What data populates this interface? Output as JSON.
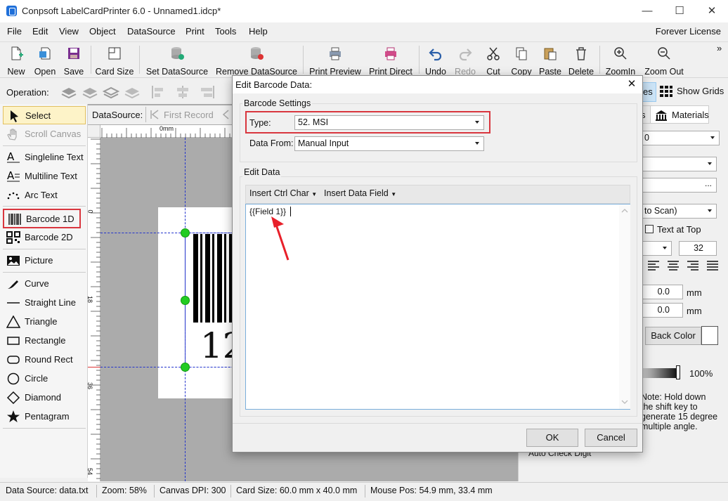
{
  "window": {
    "title": "Conpsoft LabelCardPrinter 6.0 - Unnamed1.idcp*",
    "minimize": "—",
    "maximize": "☐",
    "close": "✕"
  },
  "menu": [
    "File",
    "Edit",
    "View",
    "Object",
    "DataSource",
    "Print",
    "Tools",
    "Help"
  ],
  "license": "Forever License",
  "toolbar": [
    "New",
    "Open",
    "Save",
    "Card Size",
    "Set DataSource",
    "Remove DataSource",
    "Print Preview",
    "Print Direct",
    "Undo",
    "Redo",
    "Cut",
    "Copy",
    "Paste",
    "Delete",
    "ZoomIn",
    "Zoom Out"
  ],
  "overflow": "»",
  "operation_label": "Operation:",
  "right_tabs": {
    "partial": "es",
    "show_grids": "Show Grids"
  },
  "tools": [
    "Select",
    "Scroll Canvas",
    "Singleline Text",
    "Multiline Text",
    "Arc Text",
    "Barcode 1D",
    "Barcode 2D",
    "Picture",
    "Curve",
    "Straight Line",
    "Triangle",
    "Rectangle",
    "Round Rect",
    "Circle",
    "Diamond",
    "Pentagram"
  ],
  "datasource_bar": {
    "label": "DataSource:",
    "first_record": "First Record"
  },
  "ruler": {
    "top_zero": "0mm",
    "left_marks": [
      "0",
      "18",
      "36",
      "54"
    ]
  },
  "card": {
    "barcode_text": "12"
  },
  "right_panel": {
    "tab_partial": "s",
    "tab_materials": "Materials",
    "field1": "0",
    "field3": "...",
    "scan_combo": "to Scan)",
    "text_at_top": "Text at Top",
    "font_size": "32",
    "x_value": "0.0",
    "y_value": "0.0",
    "unit": "mm",
    "back_color": "Back Color",
    "opacity": "100%",
    "note": [
      "Note: Hold down",
      "the shift key to",
      "generate 15 degree",
      "multiple angle."
    ],
    "auto_check": "Auto Check Digit"
  },
  "dialog": {
    "title": "Edit Barcode Data:",
    "close": "✕",
    "settings_group": "Barcode Settings",
    "type_label": "Type:",
    "type_value": "52.  MSI",
    "data_from_label": "Data From:",
    "data_from_value": "Manual Input",
    "edit_group": "Edit Data",
    "insert_ctrl": "Insert Ctrl Char",
    "insert_field": "Insert Data Field",
    "content": "{{Field 1}}",
    "ok": "OK",
    "cancel": "Cancel"
  },
  "status": {
    "data_source": "Data Source: data.txt",
    "zoom": "Zoom: 58%",
    "dpi": "Canvas DPI: 300",
    "card_size": "Card Size: 60.0 mm x 40.0 mm",
    "mouse_pos": "Mouse Pos: 54.9 mm, 33.4 mm"
  },
  "colors": {
    "highlight_red": "#d9363e",
    "handle_green": "#22cc22",
    "guide_blue": "#2233cc"
  }
}
